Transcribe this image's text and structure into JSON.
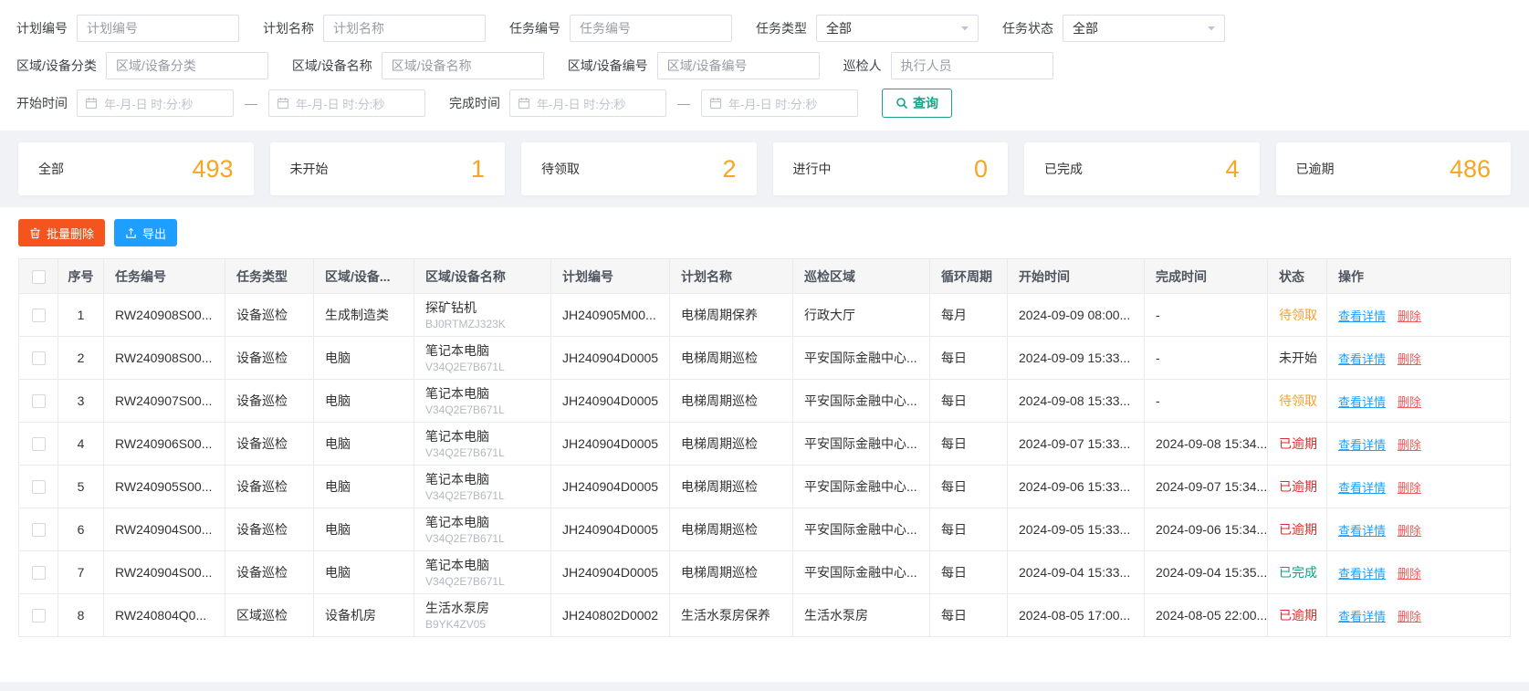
{
  "filter": {
    "plan_no_label": "计划编号",
    "plan_no_placeholder": "计划编号",
    "plan_name_label": "计划名称",
    "plan_name_placeholder": "计划名称",
    "task_no_label": "任务编号",
    "task_no_placeholder": "任务编号",
    "task_type_label": "任务类型",
    "task_type_value": "全部",
    "task_status_label": "任务状态",
    "task_status_value": "全部",
    "area_class_label": "区域/设备分类",
    "area_class_placeholder": "区域/设备分类",
    "area_name_label": "区域/设备名称",
    "area_name_placeholder": "区域/设备名称",
    "area_no_label": "区域/设备编号",
    "area_no_placeholder": "区域/设备编号",
    "inspector_label": "巡检人",
    "inspector_placeholder": "执行人员",
    "start_time_label": "开始时间",
    "finish_time_label": "完成时间",
    "date_placeholder": "年-月-日 时:分:秒",
    "range_separator": "—",
    "search_button": "查询"
  },
  "stats": [
    {
      "label": "全部",
      "value": "493"
    },
    {
      "label": "未开始",
      "value": "1"
    },
    {
      "label": "待领取",
      "value": "2"
    },
    {
      "label": "进行中",
      "value": "0"
    },
    {
      "label": "已完成",
      "value": "4"
    },
    {
      "label": "已逾期",
      "value": "486"
    }
  ],
  "toolbar": {
    "batch_delete": "批量删除",
    "export": "导出"
  },
  "table": {
    "headers": [
      "序号",
      "任务编号",
      "任务类型",
      "区域/设备...",
      "区域/设备名称",
      "计划编号",
      "计划名称",
      "巡检区域",
      "循环周期",
      "开始时间",
      "完成时间",
      "状态",
      "操作"
    ],
    "actions": {
      "view": "查看详情",
      "delete": "删除"
    },
    "rows": [
      {
        "index": "1",
        "task_no": "RW240908S00...",
        "task_type": "设备巡检",
        "device_class": "生成制造类",
        "device_name": "探矿钻机",
        "device_code": "BJ0RTMZJ323K",
        "plan_no": "JH240905M00...",
        "plan_name": "电梯周期保养",
        "area": "行政大厅",
        "cycle": "每月",
        "start": "2024-09-09 08:00...",
        "finish": "-",
        "status": "待领取",
        "status_type": "pending"
      },
      {
        "index": "2",
        "task_no": "RW240908S00...",
        "task_type": "设备巡检",
        "device_class": "电脑",
        "device_name": "笔记本电脑",
        "device_code": "V34Q2E7B671L",
        "plan_no": "JH240904D0005",
        "plan_name": "电梯周期巡检",
        "area": "平安国际金融中心...",
        "cycle": "每日",
        "start": "2024-09-09 15:33...",
        "finish": "-",
        "status": "未开始",
        "status_type": "notstarted"
      },
      {
        "index": "3",
        "task_no": "RW240907S00...",
        "task_type": "设备巡检",
        "device_class": "电脑",
        "device_name": "笔记本电脑",
        "device_code": "V34Q2E7B671L",
        "plan_no": "JH240904D0005",
        "plan_name": "电梯周期巡检",
        "area": "平安国际金融中心...",
        "cycle": "每日",
        "start": "2024-09-08 15:33...",
        "finish": "-",
        "status": "待领取",
        "status_type": "pending"
      },
      {
        "index": "4",
        "task_no": "RW240906S00...",
        "task_type": "设备巡检",
        "device_class": "电脑",
        "device_name": "笔记本电脑",
        "device_code": "V34Q2E7B671L",
        "plan_no": "JH240904D0005",
        "plan_name": "电梯周期巡检",
        "area": "平安国际金融中心...",
        "cycle": "每日",
        "start": "2024-09-07 15:33...",
        "finish": "2024-09-08 15:34...",
        "status": "已逾期",
        "status_type": "overdue"
      },
      {
        "index": "5",
        "task_no": "RW240905S00...",
        "task_type": "设备巡检",
        "device_class": "电脑",
        "device_name": "笔记本电脑",
        "device_code": "V34Q2E7B671L",
        "plan_no": "JH240904D0005",
        "plan_name": "电梯周期巡检",
        "area": "平安国际金融中心...",
        "cycle": "每日",
        "start": "2024-09-06 15:33...",
        "finish": "2024-09-07 15:34...",
        "status": "已逾期",
        "status_type": "overdue"
      },
      {
        "index": "6",
        "task_no": "RW240904S00...",
        "task_type": "设备巡检",
        "device_class": "电脑",
        "device_name": "笔记本电脑",
        "device_code": "V34Q2E7B671L",
        "plan_no": "JH240904D0005",
        "plan_name": "电梯周期巡检",
        "area": "平安国际金融中心...",
        "cycle": "每日",
        "start": "2024-09-05 15:33...",
        "finish": "2024-09-06 15:34...",
        "status": "已逾期",
        "status_type": "overdue"
      },
      {
        "index": "7",
        "task_no": "RW240904S00...",
        "task_type": "设备巡检",
        "device_class": "电脑",
        "device_name": "笔记本电脑",
        "device_code": "V34Q2E7B671L",
        "plan_no": "JH240904D0005",
        "plan_name": "电梯周期巡检",
        "area": "平安国际金融中心...",
        "cycle": "每日",
        "start": "2024-09-04 15:33...",
        "finish": "2024-09-04 15:35...",
        "status": "已完成",
        "status_type": "done"
      },
      {
        "index": "8",
        "task_no": "RW240804Q0...",
        "task_type": "区域巡检",
        "device_class": "设备机房",
        "device_name": "生活水泵房",
        "device_code": "B9YK4ZV05",
        "plan_no": "JH240802D0002",
        "plan_name": "生活水泵房保养",
        "area": "生活水泵房",
        "cycle": "每日",
        "start": "2024-08-05 17:00...",
        "finish": "2024-08-05 22:00...",
        "status": "已逾期",
        "status_type": "overdue"
      }
    ]
  },
  "colors": {
    "stat_number_orange": "#f5a623",
    "batch_delete_red": "#f4541e",
    "export_blue": "#1e9fff",
    "search_teal": "#1aa187",
    "status_pending": "#f0a22a",
    "status_overdue": "#e02b2b",
    "status_done": "#0ca184",
    "link_view_blue": "#1e9fff",
    "link_delete_red": "#f15b5b"
  }
}
